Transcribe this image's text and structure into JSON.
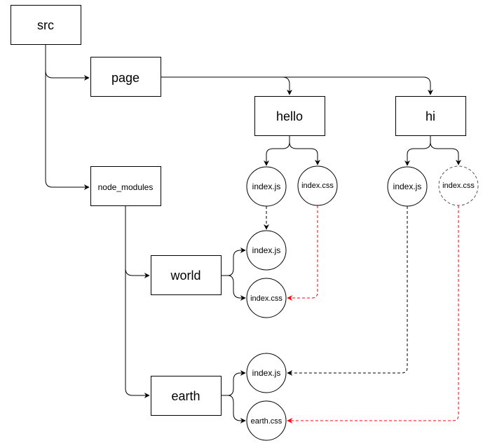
{
  "diagram": {
    "folders": {
      "src": "src",
      "page": "page",
      "hello": "hello",
      "hi": "hi",
      "node_modules": "node_modules",
      "world": "world",
      "earth": "earth"
    },
    "files": {
      "hello_js": "index.js",
      "hello_css": "index.css",
      "hi_js": "index.js",
      "hi_css": "index.css",
      "world_js": "index.js",
      "world_css": "index.css",
      "earth_js": "index.js",
      "earth_css": "earth.css"
    },
    "colors": {
      "line": "#000000",
      "red_dependency": "#ff0000",
      "missing_file_border": "#555555"
    },
    "edges": [
      {
        "from": "src",
        "to": "page",
        "style": "solid"
      },
      {
        "from": "src",
        "to": "node_modules",
        "style": "solid"
      },
      {
        "from": "page",
        "to": "hello",
        "style": "solid"
      },
      {
        "from": "page",
        "to": "hi",
        "style": "solid"
      },
      {
        "from": "hello",
        "to": "hello/index.js",
        "style": "solid"
      },
      {
        "from": "hello",
        "to": "hello/index.css",
        "style": "solid"
      },
      {
        "from": "hi",
        "to": "hi/index.js",
        "style": "solid"
      },
      {
        "from": "hi",
        "to": "hi/index.css",
        "style": "solid"
      },
      {
        "from": "node_modules",
        "to": "world",
        "style": "solid"
      },
      {
        "from": "node_modules",
        "to": "earth",
        "style": "solid"
      },
      {
        "from": "world",
        "to": "world/index.js",
        "style": "solid"
      },
      {
        "from": "world",
        "to": "world/index.css",
        "style": "solid"
      },
      {
        "from": "earth",
        "to": "earth/index.js",
        "style": "solid"
      },
      {
        "from": "earth",
        "to": "earth/earth.css",
        "style": "solid"
      },
      {
        "from": "hello/index.js",
        "to": "world/index.js",
        "style": "dashed-black"
      },
      {
        "from": "hello/index.css",
        "to": "world/index.css",
        "style": "dashed-red"
      },
      {
        "from": "hi/index.js",
        "to": "earth/index.js",
        "style": "dashed-black"
      },
      {
        "from": "hi/index.css",
        "to": "earth/earth.css",
        "style": "dashed-red"
      }
    ]
  }
}
